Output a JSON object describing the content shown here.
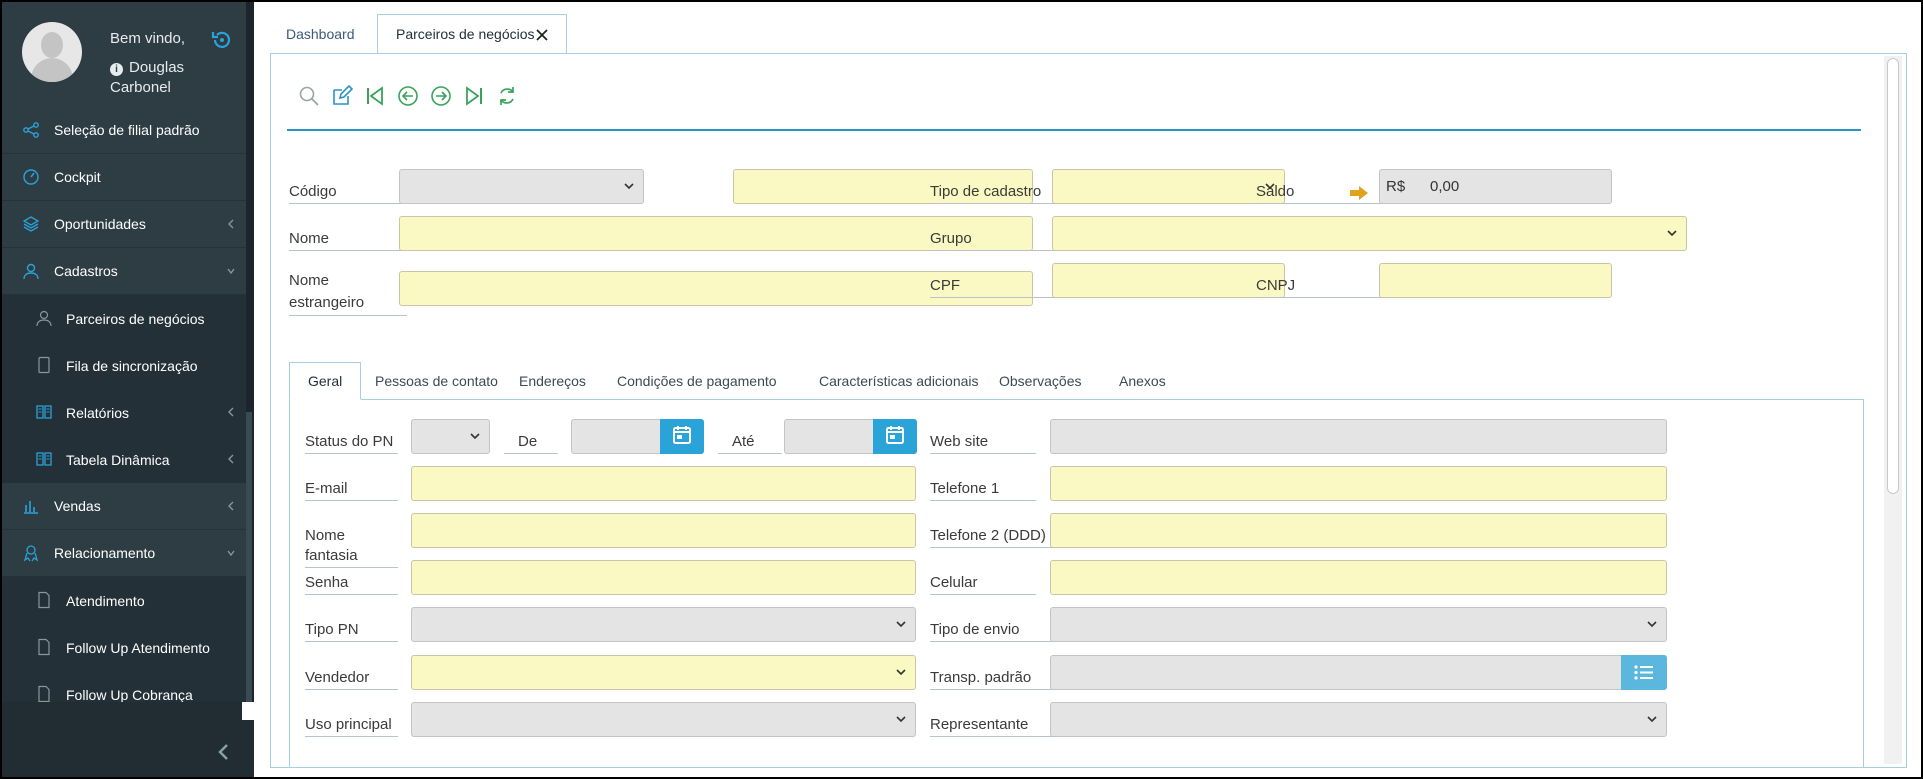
{
  "sidebar": {
    "welcome": "Bem vindo,",
    "user_name": "Douglas Carbonel",
    "items": [
      {
        "label": "Seleção de filial padrão",
        "icon": "share-icon"
      },
      {
        "label": "Cockpit",
        "icon": "gauge-icon"
      },
      {
        "label": "Oportunidades",
        "icon": "layers-icon"
      },
      {
        "label": "Cadastros",
        "icon": "user-icon"
      },
      {
        "label": "Parceiros de negócios",
        "icon": "user-outline-icon"
      },
      {
        "label": "Fila de sincronização",
        "icon": "tablet-icon"
      },
      {
        "label": "Relatórios",
        "icon": "book-icon"
      },
      {
        "label": "Tabela Dinâmica",
        "icon": "book-icon"
      },
      {
        "label": "Vendas",
        "icon": "bar-chart-icon"
      },
      {
        "label": "Relacionamento",
        "icon": "handshake-icon"
      },
      {
        "label": "Atendimento",
        "icon": "file-icon"
      },
      {
        "label": "Follow Up Atendimento",
        "icon": "file-icon"
      },
      {
        "label": "Follow Up Cobrança",
        "icon": "file-icon"
      }
    ]
  },
  "tabs": [
    {
      "label": "Dashboard"
    },
    {
      "label": "Parceiros de negócios"
    }
  ],
  "form": {
    "codigo_label": "Código",
    "tipo_cadastro_label": "Tipo de cadastro",
    "saldo_label": "Saldo",
    "saldo_currency": "R$",
    "saldo_value": "0,00",
    "nome_label": "Nome",
    "grupo_label": "Grupo",
    "nome_estrangeiro_label_1": "Nome",
    "nome_estrangeiro_label_2": "estrangeiro",
    "cpf_label": "CPF",
    "cnpj_label": "CNPJ"
  },
  "inner_tabs": [
    "Geral",
    "Pessoas de contato",
    "Endereços",
    "Condições de pagamento",
    "Características adicionais",
    "Observações",
    "Anexos"
  ],
  "geral": {
    "status_pn_label": "Status do PN",
    "de_label": "De",
    "ate_label": "Até",
    "website_label": "Web site",
    "email_label": "E-mail",
    "telefone1_label": "Telefone 1",
    "nome_fantasia_label": "Nome fantasia",
    "telefone2_label": "Telefone 2 (DDD)",
    "senha_label": "Senha",
    "celular_label": "Celular",
    "tipo_pn_label": "Tipo PN",
    "tipo_envio_label": "Tipo de envio",
    "vendedor_label": "Vendedor",
    "transp_label": "Transp. padrão",
    "uso_principal_label": "Uso principal",
    "representante_label": "Representante"
  },
  "colors": {
    "accent": "#2a94c9",
    "sidebar_bg": "#243038",
    "required_field": "#fbf9c3",
    "toolbar_green": "#3aa35b"
  }
}
